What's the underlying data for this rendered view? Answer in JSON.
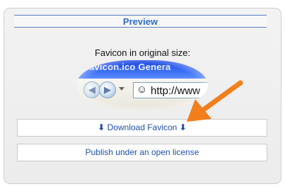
{
  "panel": {
    "title": "Preview",
    "preview_label": "Favicon in original size:"
  },
  "browser_mock": {
    "title_text": "avicon.ico Genera",
    "address_text": "http://www"
  },
  "buttons": {
    "download_label": "Download Favicon",
    "download_icon_glyph": "⬇",
    "publish_label": "Publish under an open license"
  },
  "colors": {
    "accent_blue": "#2f6bc9",
    "link_blue": "#1d4fa8",
    "annotation_orange": "#f27f1b"
  }
}
